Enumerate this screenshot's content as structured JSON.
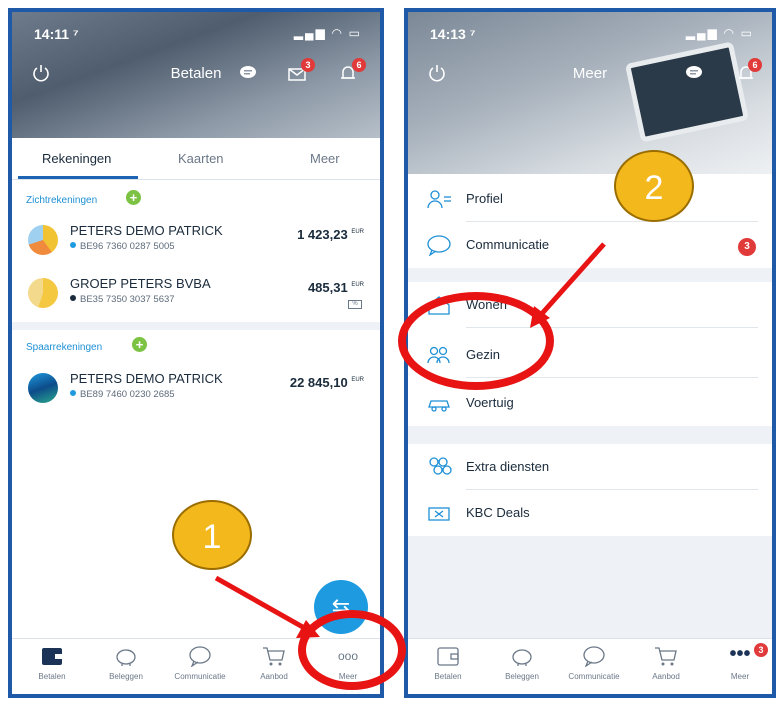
{
  "left": {
    "status_time": "14:11 ⁷",
    "header_title": "Betalen",
    "notif_badge_1": "3",
    "notif_badge_2": "6",
    "tabs": [
      "Rekeningen",
      "Kaarten",
      "Meer"
    ],
    "section_current": "Zichtrekeningen",
    "section_savings": "Spaarrekeningen",
    "accounts": [
      {
        "name": "PETERS DEMO PATRICK",
        "iban": "BE96 7360 0287 5005",
        "amount": "1 423,23",
        "currency": "EUR"
      },
      {
        "name": "GROEP PETERS BVBA",
        "iban": "BE35 7350 3037 5637",
        "amount": "485,31",
        "currency": "EUR"
      },
      {
        "name": "PETERS DEMO PATRICK",
        "iban": "BE89 7460 0230 2685",
        "amount": "22 845,10",
        "currency": "EUR"
      }
    ],
    "nav": [
      "Betalen",
      "Beleggen",
      "Communicatie",
      "Aanbod",
      "Meer"
    ],
    "more_dots": "ooo"
  },
  "right": {
    "status_time": "14:13 ⁷",
    "header_title": "Meer",
    "notif_badge": "6",
    "menu": [
      {
        "label": "Profiel"
      },
      {
        "label": "Communicatie",
        "badge": "3"
      },
      {
        "label": "Wonen"
      },
      {
        "label": "Gezin"
      },
      {
        "label": "Voertuig"
      },
      {
        "label": "Extra diensten"
      },
      {
        "label": "KBC Deals"
      }
    ],
    "nav": [
      "Betalen",
      "Beleggen",
      "Communicatie",
      "Aanbod",
      "Meer"
    ],
    "nav_badge": "3"
  },
  "annotations": {
    "step1": "1",
    "step2": "2"
  },
  "colors": {
    "frame": "#1e5aa8",
    "accent": "#1e9be0",
    "callout": "#f3b81c",
    "ring": "#e81313",
    "badge": "#e03a3a",
    "plus": "#7cc243"
  }
}
